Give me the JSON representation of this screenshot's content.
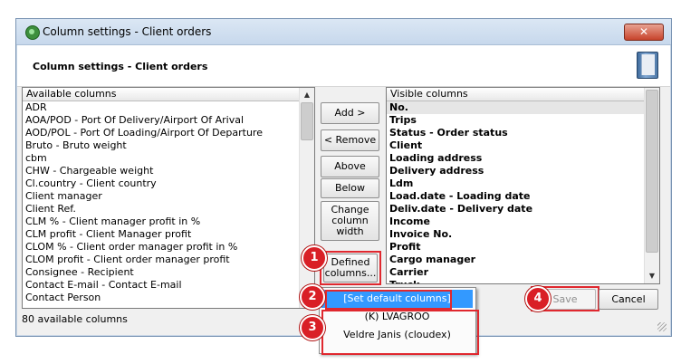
{
  "window": {
    "title": "Column settings - Client orders",
    "close_label": "✕",
    "header_title": "Column settings - Client orders"
  },
  "available": {
    "header": "Available columns",
    "items": [
      "ADR",
      "AOA/POD - Port Of Delivery/Airport Of Arival",
      "AOD/POL - Port Of Loading/Airport Of Departure",
      "Bruto - Bruto weight",
      "cbm",
      "CHW - Chargeable weight",
      "Cl.country - Client country",
      "Client manager",
      "Client Ref.",
      "CLM % - Client manager profit in %",
      "CLM profit - Client Manager profit",
      "CLOM % - Client order manager profit in %",
      "CLOM profit - Client order manager profit",
      "Consignee - Recipient",
      "Contact E-mail - Contact E-mail",
      "Contact Person"
    ],
    "status": "80 available columns"
  },
  "visible": {
    "header": "Visible columns",
    "items": [
      "No.",
      "Trips",
      "Status - Order status",
      "Client",
      "Loading address",
      "Delivery address",
      "Ldm",
      "Load.date - Loading date",
      "Deliv.date - Delivery date",
      "Income",
      "Invoice No.",
      "Profit",
      "Cargo manager",
      "Carrier",
      "Truck"
    ]
  },
  "buttons": {
    "add": "Add >",
    "remove": "< Remove",
    "above": "Above",
    "below": "Below",
    "change_width": "Change column width",
    "defined_columns": "Defined columns...",
    "save": "Save",
    "cancel": "Cancel"
  },
  "dropdown": {
    "items": [
      "[Set default columns]",
      "(K) LVAGROO",
      "Veldre Janis (cloudex)"
    ],
    "selected_index": 0
  },
  "badges": [
    "1",
    "2",
    "3",
    "4"
  ],
  "colors": {
    "highlight": "#3399ff",
    "annotation_red": "#d91f26",
    "list_selection": "#e6e6e6"
  }
}
